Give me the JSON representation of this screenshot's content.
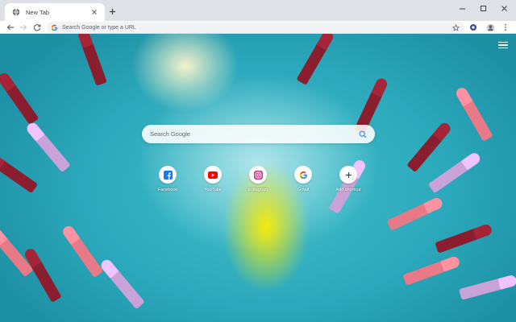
{
  "tab": {
    "title": "New Tab"
  },
  "omnibox": {
    "placeholder": "Search Google or type a URL"
  },
  "ntp": {
    "search_placeholder": "Search Google",
    "shortcuts": [
      {
        "label": "Facebook",
        "icon": "facebook-icon"
      },
      {
        "label": "YouTube",
        "icon": "youtube-icon"
      },
      {
        "label": "Instagram",
        "icon": "instagram-icon"
      },
      {
        "label": "Gmail",
        "icon": "google-icon"
      },
      {
        "label": "Add shortcut",
        "icon": "plus-icon"
      }
    ]
  },
  "colors": {
    "tabstrip": "#dee1e6",
    "water": "#2ba8bb",
    "swimsuit": "#ffec00",
    "lipstick_dark": "#8a1e2e",
    "lipstick_pink": "#e77a86",
    "lipstick_lilac": "#c9a3d8",
    "facebook": "#1877f2",
    "youtube": "#ff0000"
  }
}
